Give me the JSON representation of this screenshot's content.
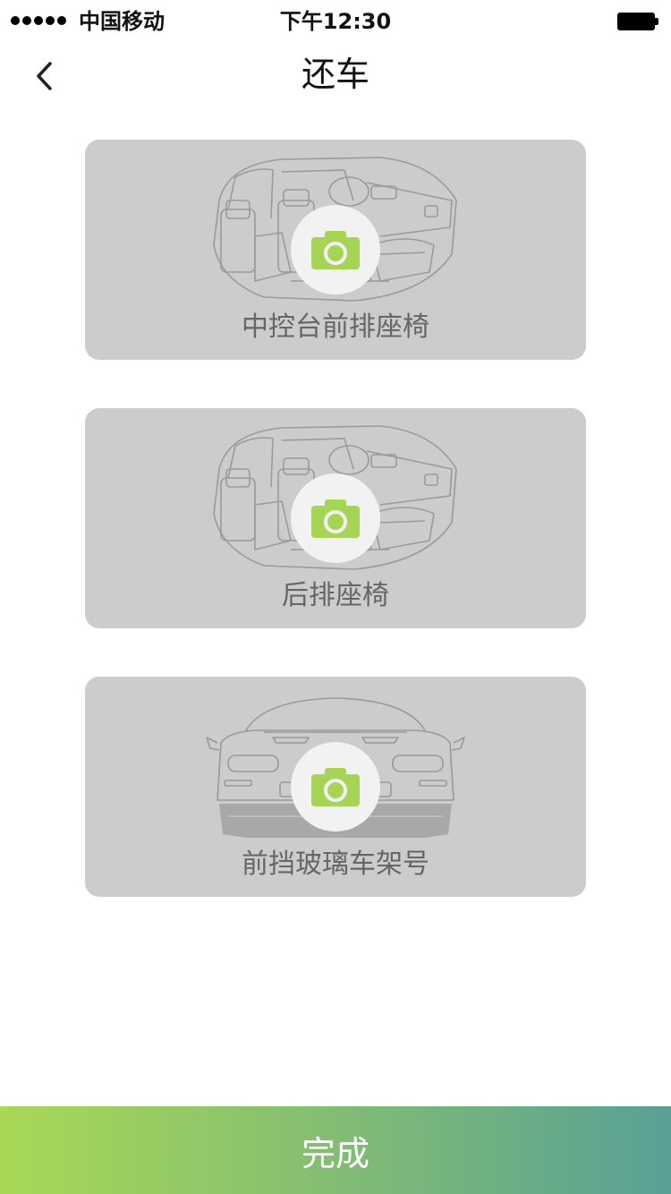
{
  "status_bar": {
    "carrier": "中国移动",
    "time": "下午12:30",
    "icons": [
      "signal-dots-icon",
      "battery-icon"
    ]
  },
  "nav": {
    "title": "还车",
    "back_icon": "chevron-left-icon"
  },
  "cards": [
    {
      "label": "中控台前排座椅",
      "illustration": "car-interior-front",
      "icon": "camera-icon"
    },
    {
      "label": "后排座椅",
      "illustration": "car-interior-rear",
      "icon": "camera-icon"
    },
    {
      "label": "前挡玻璃车架号",
      "illustration": "car-front-view",
      "icon": "camera-icon"
    }
  ],
  "footer": {
    "done_label": "完成"
  },
  "colors": {
    "accent_green": "#a9d856",
    "gradient_end": "#58a096",
    "card_bg": "#cccccc",
    "label_text": "#666666"
  }
}
